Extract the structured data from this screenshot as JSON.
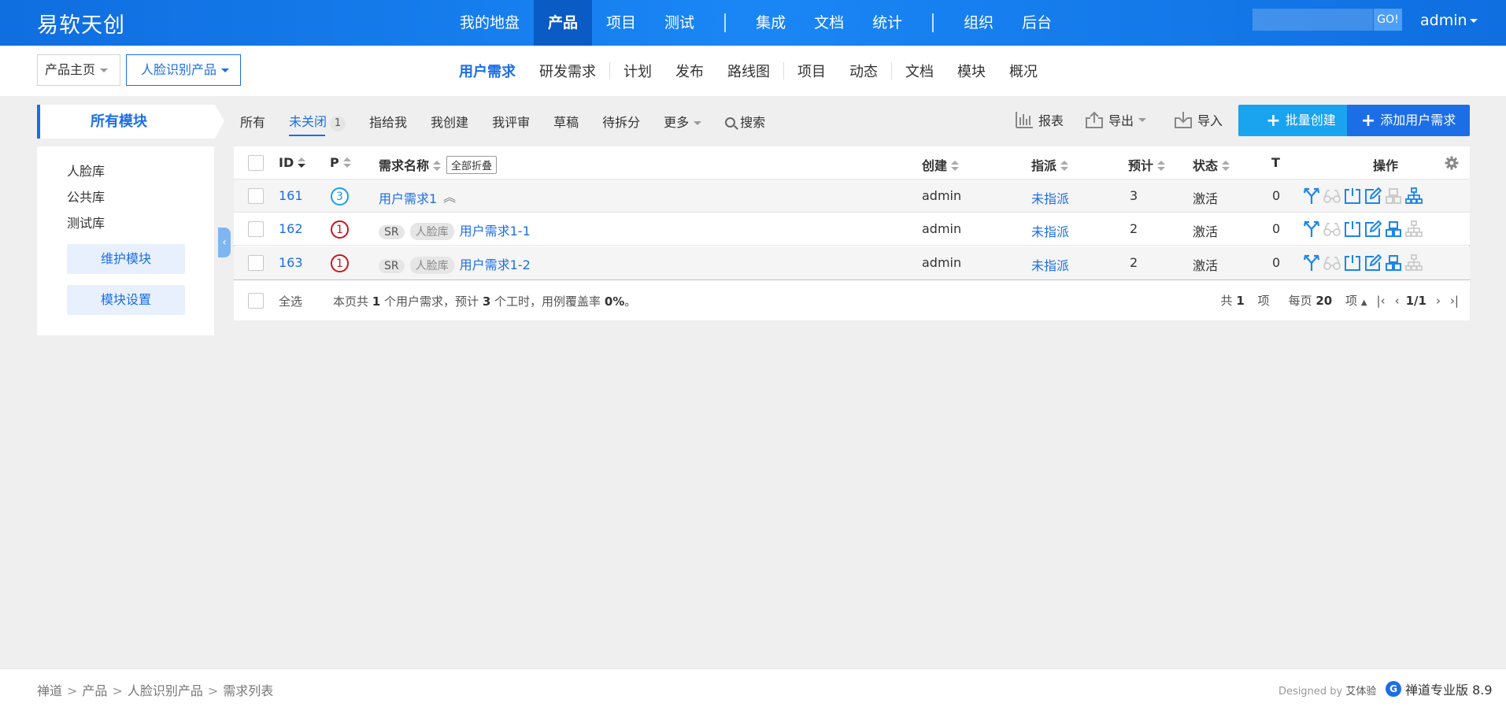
{
  "header": {
    "brand": "易软天创",
    "nav": [
      "我的地盘",
      "产品",
      "项目",
      "测试",
      "集成",
      "文档",
      "统计",
      "组织",
      "后台"
    ],
    "active_nav": "产品",
    "search_placeholder": "",
    "go_label": "GO!",
    "user": "admin"
  },
  "subheader": {
    "home_label": "产品主页",
    "product_label": "人脸识别产品",
    "tabs": [
      "用户需求",
      "研发需求",
      "计划",
      "发布",
      "路线图",
      "项目",
      "动态",
      "文档",
      "模块",
      "概况"
    ],
    "active_tab": "用户需求"
  },
  "sidebar": {
    "title": "所有模块",
    "modules": [
      "人脸库",
      "公共库",
      "测试库"
    ],
    "maintain_button": "维护模块",
    "settings_button": "模块设置"
  },
  "filters": {
    "tabs": [
      "所有",
      "未关闭",
      "指给我",
      "我创建",
      "我评审",
      "草稿",
      "待拆分",
      "更多"
    ],
    "active_tab": "未关闭",
    "unclosed_count": "1",
    "search_label": "搜索"
  },
  "toolbar": {
    "report_label": "报表",
    "export_label": "导出",
    "import_label": "导入",
    "batch_create_label": "批量创建",
    "add_story_label": "添加用户需求"
  },
  "table": {
    "columns": {
      "id": "ID",
      "pri": "P",
      "title": "需求名称",
      "collapse_all": "全部折叠",
      "creator": "创建",
      "assigned": "指派",
      "estimate": "预计",
      "status": "状态",
      "t": "T",
      "actions": "操作"
    },
    "rows": [
      {
        "id": "161",
        "pri": "3",
        "type_tag": "",
        "module_tag": "",
        "title": "用户需求1",
        "creator": "admin",
        "assigned": "未指派",
        "estimate": "3",
        "status": "激活",
        "t": "0"
      },
      {
        "id": "162",
        "pri": "1",
        "type_tag": "SR",
        "module_tag": "人脸库",
        "title": "用户需求1-1",
        "creator": "admin",
        "assigned": "未指派",
        "estimate": "2",
        "status": "激活",
        "t": "0"
      },
      {
        "id": "163",
        "pri": "1",
        "type_tag": "SR",
        "module_tag": "人脸库",
        "title": "用户需求1-2",
        "creator": "admin",
        "assigned": "未指派",
        "estimate": "2",
        "status": "激活",
        "t": "0"
      }
    ],
    "select_all_label": "全选",
    "summary": {
      "prefix": "本页共",
      "count": "1",
      "mid1": "个用户需求，预计",
      "hours": "3",
      "mid2": "个工时，用例覆盖率",
      "coverage": "0%",
      "suffix": "。"
    },
    "pager": {
      "total_prefix": "共",
      "total": "1",
      "total_suffix": "项",
      "per_page_prefix": "每页",
      "per_page": "20",
      "per_page_suffix": "项",
      "page": "1/1"
    }
  },
  "footer": {
    "breadcrumb": [
      "禅道",
      "产品",
      "人脸识别产品",
      "需求列表"
    ],
    "designed_by_prefix": "Designed by",
    "designed_by": "艾体验",
    "product_name": "禅道专业版 8.9"
  },
  "colors": {
    "primary": "#1c6ee6",
    "accent": "#1aa3ef",
    "priority_high": "#c8161d",
    "priority_low": "#1a9de8"
  }
}
